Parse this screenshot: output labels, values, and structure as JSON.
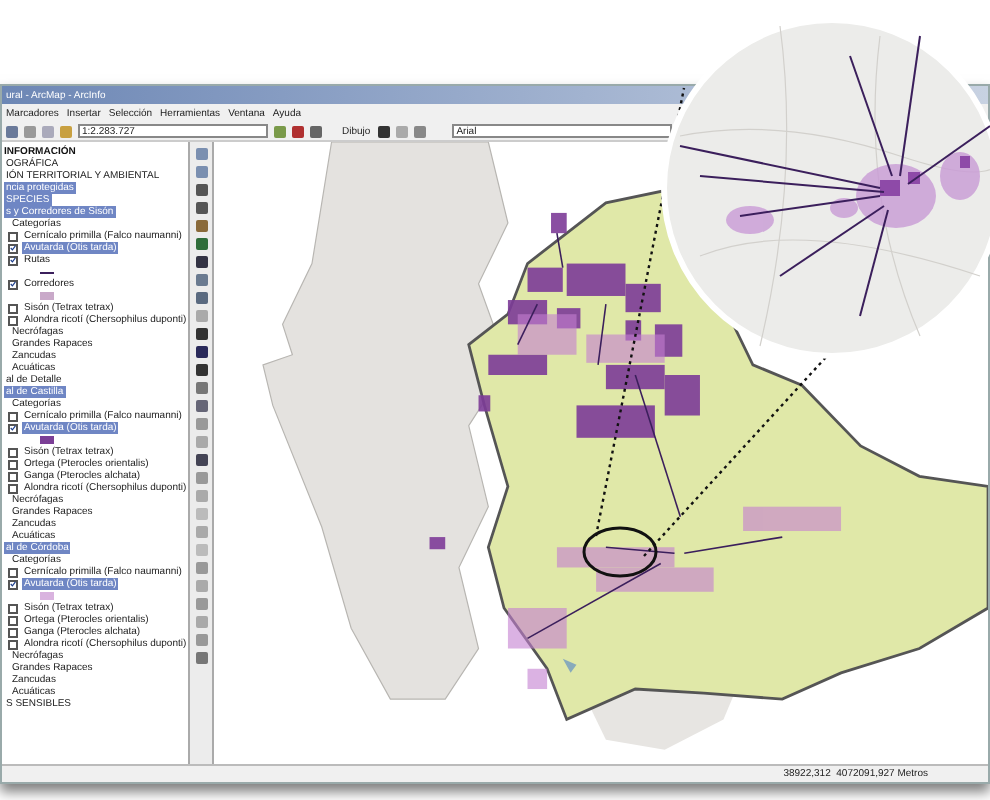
{
  "window": {
    "title": "ural - ArcMap - ArcInfo"
  },
  "menu": [
    {
      "label": "Marcadores"
    },
    {
      "label": "Insertar"
    },
    {
      "label": "Selección"
    },
    {
      "label": "Herramientas"
    },
    {
      "label": "Ventana"
    },
    {
      "label": "Ayuda"
    }
  ],
  "toolbar": {
    "scale": "1:2.283.727",
    "draw_menu": "Dibujo",
    "font": "Arial"
  },
  "toc": [
    {
      "kind": "heading",
      "label": "INFORMACIÓN"
    },
    {
      "kind": "group",
      "label": "OGRÁFICA"
    },
    {
      "kind": "group",
      "label": "IÓN TERRITORIAL Y AMBIENTAL"
    },
    {
      "kind": "layer",
      "label": "ncia protegidas",
      "highlighted": true
    },
    {
      "kind": "group",
      "label": "SPECIES",
      "highlighted": true
    },
    {
      "kind": "layer",
      "label": "s y Corredores de Sisón",
      "highlighted": true
    },
    {
      "kind": "category",
      "label": "Categorías"
    },
    {
      "kind": "check",
      "label": "Cernícalo primilla (Falco naumanni)",
      "checked": false,
      "highlighted": false
    },
    {
      "kind": "check",
      "label": "Avutarda (Otis tarda)",
      "checked": true,
      "highlighted": true
    },
    {
      "kind": "check",
      "label": "Rutas",
      "checked": true,
      "highlighted": false
    },
    {
      "kind": "line-swatch",
      "color": "#3b1f5c"
    },
    {
      "kind": "check",
      "label": "Corredores",
      "checked": true,
      "highlighted": false
    },
    {
      "kind": "hatch-swatch",
      "color": "#c9a9c9"
    },
    {
      "kind": "check",
      "label": "Sisón (Tetrax tetrax)",
      "checked": false,
      "highlighted": false
    },
    {
      "kind": "check",
      "label": "Alondra ricotí (Chersophilus duponti)",
      "checked": false,
      "highlighted": false
    },
    {
      "kind": "category",
      "label": "Necrófagas"
    },
    {
      "kind": "category",
      "label": "Grandes Rapaces"
    },
    {
      "kind": "category",
      "label": "Zancudas"
    },
    {
      "kind": "category",
      "label": "Acuáticas"
    },
    {
      "kind": "layer",
      "label": "al de Detalle",
      "highlighted": false
    },
    {
      "kind": "layer",
      "label": "al de Castilla",
      "highlighted": true
    },
    {
      "kind": "category",
      "label": "Categorías"
    },
    {
      "kind": "check",
      "label": "Cernícalo primilla (Falco naumanni)",
      "checked": false,
      "highlighted": false
    },
    {
      "kind": "check",
      "label": "Avutarda (Otis tarda)",
      "checked": true,
      "highlighted": true
    },
    {
      "kind": "fill-swatch",
      "color": "#7b3f96"
    },
    {
      "kind": "check",
      "label": "Sisón (Tetrax tetrax)",
      "checked": false,
      "highlighted": false
    },
    {
      "kind": "check",
      "label": "Ortega (Pterocles orientalis)",
      "checked": false,
      "highlighted": false
    },
    {
      "kind": "check",
      "label": "Ganga (Pterocles alchata)",
      "checked": false,
      "highlighted": false
    },
    {
      "kind": "check",
      "label": "Alondra ricotí (Chersophilus duponti)",
      "checked": false,
      "highlighted": false
    },
    {
      "kind": "category",
      "label": "Necrófagas"
    },
    {
      "kind": "category",
      "label": "Grandes Rapaces"
    },
    {
      "kind": "category",
      "label": "Zancudas"
    },
    {
      "kind": "category",
      "label": "Acuáticas"
    },
    {
      "kind": "layer",
      "label": "al de Córdoba",
      "highlighted": true
    },
    {
      "kind": "category",
      "label": "Categorías"
    },
    {
      "kind": "check",
      "label": "Cernícalo primilla (Falco naumanni)",
      "checked": false,
      "highlighted": false
    },
    {
      "kind": "check",
      "label": "Avutarda (Otis tarda)",
      "checked": true,
      "highlighted": true
    },
    {
      "kind": "fill-swatch",
      "color": "#d9b3df"
    },
    {
      "kind": "check",
      "label": "Sisón (Tetrax tetrax)",
      "checked": false,
      "highlighted": false
    },
    {
      "kind": "check",
      "label": "Ortega (Pterocles orientalis)",
      "checked": false,
      "highlighted": false
    },
    {
      "kind": "check",
      "label": "Ganga (Pterocles alchata)",
      "checked": false,
      "highlighted": false
    },
    {
      "kind": "check",
      "label": "Alondra ricotí (Chersophilus duponti)",
      "checked": false,
      "highlighted": false
    },
    {
      "kind": "category",
      "label": "Necrófagas"
    },
    {
      "kind": "category",
      "label": "Grandes Rapaces"
    },
    {
      "kind": "category",
      "label": "Zancudas"
    },
    {
      "kind": "category",
      "label": "Acuáticas"
    },
    {
      "kind": "group",
      "label": "S SENSIBLES"
    }
  ],
  "status_bar": {
    "coordinates": "38922,312  4072091,927 Metros"
  }
}
